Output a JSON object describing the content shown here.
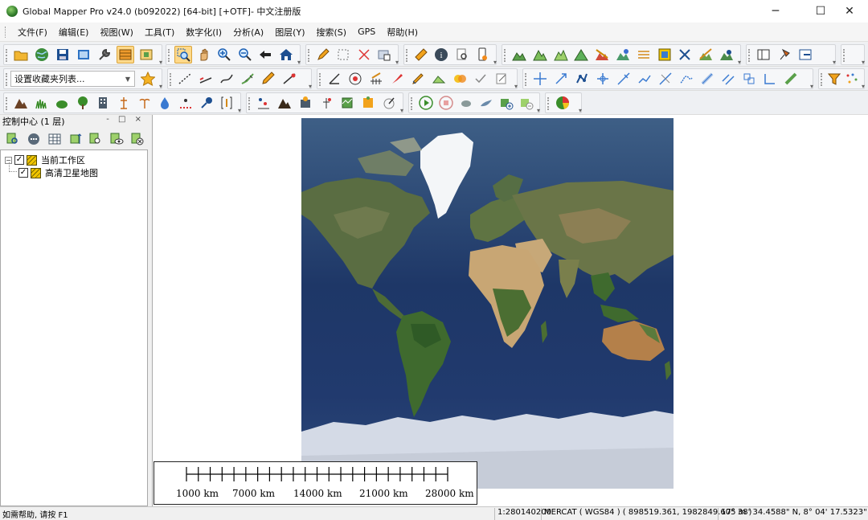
{
  "window": {
    "title": "Global Mapper Pro v24.0 (b092022) [64-bit] [+OTF]- 中文注册版",
    "minimize_glyph": "─",
    "maximize_glyph": "☐",
    "close_glyph": "✕"
  },
  "menu": {
    "items": [
      "文件(F)",
      "编辑(E)",
      "视图(W)",
      "工具(T)",
      "数字化(I)",
      "分析(A)",
      "图层(Y)",
      "搜索(S)",
      "GPS",
      "帮助(H)"
    ]
  },
  "toolbar": {
    "favorites_placeholder": "设置收藏夹列表...",
    "icons_row1": [
      "open-folder-icon",
      "globe-data-icon",
      "save-icon",
      "export-raster-icon",
      "config-wrench-icon",
      "layer-toggle-icon",
      "overview-icon",
      "zoom-window-icon",
      "pan-hand-icon",
      "zoom-in-icon",
      "zoom-out-icon",
      "back-arrow-icon",
      "home-extent-icon",
      "digitizer-pencil-icon",
      "select-box-icon",
      "delete-x-icon",
      "select-area-icon",
      "measure-ruler-icon",
      "info-icon",
      "find-icon",
      "gps-device-icon",
      "terrain-1-icon",
      "terrain-2-icon",
      "terrain-3-icon",
      "terrain-4-icon",
      "terrain-5-icon",
      "terrain-6-icon",
      "contour-icon",
      "map-layout-icon",
      "cross-tool-icon",
      "terrain-7-icon",
      "terrain-8-icon",
      "dock-panel-icon",
      "pin-tool-icon",
      "split-view-icon"
    ],
    "selected_tool": "zoom-window-icon"
  },
  "control_center": {
    "title": "控制中心 (1 层)",
    "header_controls": "- □ ×",
    "layers_root": {
      "label": "当前工作区",
      "checked": true,
      "expander": "−"
    },
    "layers": [
      {
        "label": "高清卫星地图",
        "checked": true
      }
    ]
  },
  "map": {
    "scale_labels": [
      "1000 km",
      "7000 km",
      "14000 km",
      "21000 km",
      "28000 km"
    ]
  },
  "status": {
    "help": "如需帮助, 请按 F1",
    "scale": "1:280140200",
    "projection": "MERCAT ( WGS84 ) ( 898519.361, 1982849.605 m )",
    "coords": "17° 38' 34.4588\" N, 8° 04' 17.5323\" E"
  }
}
